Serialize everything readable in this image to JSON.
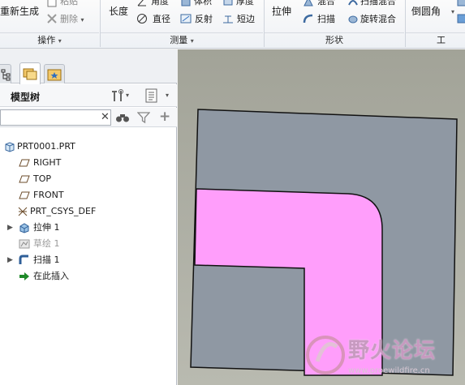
{
  "ribbon": {
    "groups": [
      {
        "label": "操作",
        "dropdown": "▾"
      },
      {
        "label": "测量",
        "dropdown": "▾"
      },
      {
        "label": "形状",
        "dropdown": ""
      }
    ],
    "ops": {
      "regenerate": "重新生成",
      "paste": "粘贴",
      "delete": "删除"
    },
    "measure": {
      "length": "长度",
      "angle": "角度",
      "volume": "体积",
      "thickness": "厚度",
      "diameter": "直径",
      "reflect": "反射",
      "short_edge": "短边"
    },
    "shape": {
      "extrude": "拉伸",
      "blend": "混合",
      "sweep_blend": "扫描混合",
      "sweep": "扫描",
      "rotate_blend": "旋转混合"
    },
    "eng": {
      "round": "倒圆角",
      "group_stub": "工"
    },
    "colors": {
      "ribbon_bg": "#eef1f5",
      "accent": "#2f6fbf"
    }
  },
  "panel": {
    "tree_title": "模型树",
    "search": {
      "value": "",
      "placeholder": ""
    },
    "tabs": [
      "model-tree-tab",
      "layer-tab",
      "favorites-tab"
    ],
    "nodes": [
      {
        "label": "PRT0001.PRT",
        "icon": "part-icon",
        "expand": ""
      },
      {
        "label": "RIGHT",
        "icon": "datum-plane-icon",
        "expand": ""
      },
      {
        "label": "TOP",
        "icon": "datum-plane-icon",
        "expand": ""
      },
      {
        "label": "FRONT",
        "icon": "datum-plane-icon",
        "expand": ""
      },
      {
        "label": "PRT_CSYS_DEF",
        "icon": "csys-icon",
        "expand": ""
      },
      {
        "label": "拉伸 1",
        "icon": "extrude-icon",
        "expand": "▶"
      },
      {
        "label": "草绘 1",
        "icon": "sketch-icon",
        "expand": ""
      },
      {
        "label": "扫描 1",
        "icon": "sweep-icon",
        "expand": "▶"
      },
      {
        "label": "在此插入",
        "icon": "insert-here-icon",
        "expand": ""
      }
    ]
  },
  "viewport": {
    "part_color": "#8f98a3",
    "highlight_color": "#ff9efb",
    "background": "#b0b1a7"
  },
  "watermark": {
    "text": "野火论坛",
    "url": "www.proewildfire.cn"
  }
}
